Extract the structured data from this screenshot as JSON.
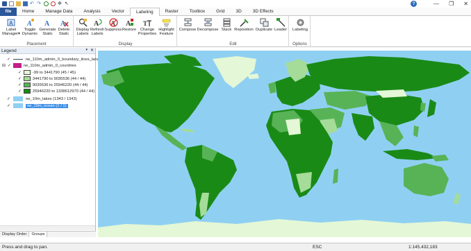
{
  "titlebar": {
    "quick_access": [
      "app-icon",
      "new-icon",
      "open-icon",
      "save-icon",
      "undo-icon",
      "redo-icon",
      "zoom-in-icon",
      "zoom-out-icon",
      "pan-icon",
      "select-icon"
    ],
    "help": "?",
    "minimize": "—",
    "restore": "❐",
    "close": "✕"
  },
  "tabs": [
    "Home",
    "Manage Data",
    "Analysis",
    "Vector",
    "Labeling",
    "Raster",
    "Toolbox",
    "Grid",
    "3D",
    "3D Effects"
  ],
  "file_tab": "file",
  "active_tab": "Labeling",
  "ribbon": {
    "placement": {
      "label": "Placement",
      "buttons": [
        {
          "line1": "Label",
          "line2": "Manager▾"
        },
        {
          "line1": "Toggle",
          "line2": "Dynamic"
        },
        {
          "line1": "Generate",
          "line2": "Static"
        },
        {
          "line1": "Delete",
          "line2": "Static"
        }
      ]
    },
    "display": {
      "label": "Display",
      "buttons": [
        {
          "line1": "Display",
          "line2": "Labels"
        },
        {
          "line1": "Refresh",
          "line2": "Labels"
        },
        {
          "line1": "Suppress",
          "line2": ""
        },
        {
          "line1": "Restore",
          "line2": ""
        },
        {
          "line1": "Change",
          "line2": "Properties"
        },
        {
          "line1": "Highlight",
          "line2": "Feature"
        }
      ]
    },
    "edit": {
      "label": "Edit",
      "buttons": [
        {
          "line1": "Compose",
          "line2": ""
        },
        {
          "line1": "Decompose",
          "line2": ""
        },
        {
          "line1": "Stack",
          "line2": ""
        },
        {
          "line1": "Reposition",
          "line2": ""
        },
        {
          "line1": "Duplicate",
          "line2": ""
        },
        {
          "line1": "Leader",
          "line2": ""
        }
      ]
    },
    "options": {
      "label": "Options",
      "buttons": [
        {
          "line1": "Labeling",
          "line2": ""
        }
      ]
    }
  },
  "legend": {
    "title": "Legend",
    "pin": "📌",
    "close": "✕",
    "layers": [
      {
        "name": "ne_110m_admin_0_boundary_lines_land (",
        "checked": true
      },
      {
        "name": "ne_110m_admin_0_countries",
        "checked": true,
        "expanded": true,
        "classes": [
          {
            "range": "-99 to 3441790 (45 / 45)",
            "color": "#e4f7d6"
          },
          {
            "range": "3441790 to 9035536 (44 / 44)",
            "color": "#a5dc99"
          },
          {
            "range": "9035536 to 25946220 (44 / 44)",
            "color": "#58b356"
          },
          {
            "range": "25946220 to 1338612970 (44 / 44)",
            "color": "#1a8a16"
          }
        ]
      },
      {
        "name": "ne_10m_lakes (1343 / 1343)",
        "checked": true,
        "swatch": "#8fd0f2"
      },
      {
        "name": "ne_10m_ocean (1 / 1)",
        "checked": true,
        "swatch": "#8fd0f2",
        "selected": true
      }
    ],
    "tabs": [
      "Display Order",
      "Groups"
    ],
    "active_tab": "Groups"
  },
  "map": {
    "ocean_color": "#8fd0f2",
    "antarctica_color": "#e4f7d6"
  },
  "status": {
    "message": "Press and drag to pan.",
    "esc": "ESC",
    "scale": "1:145,432,183"
  }
}
